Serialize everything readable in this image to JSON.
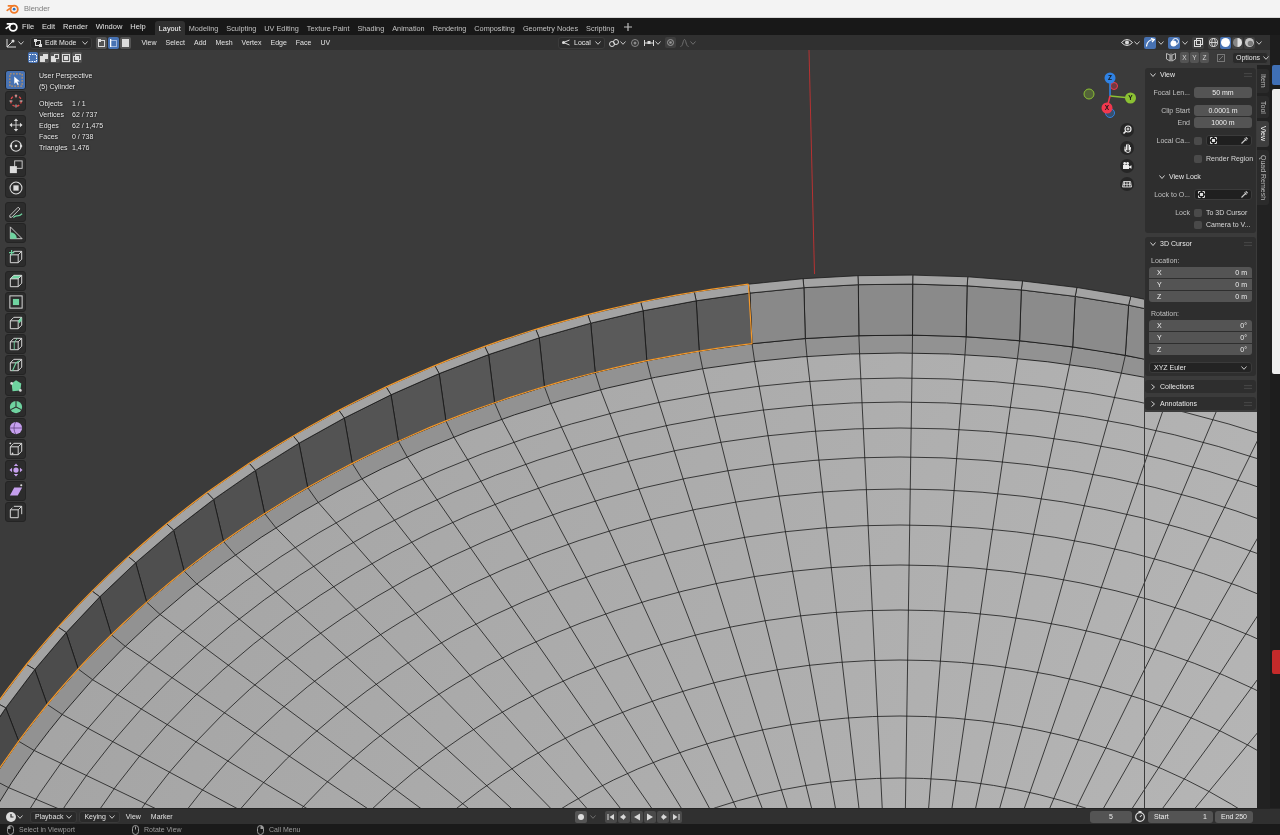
{
  "title_bar": {
    "title": "Blender"
  },
  "menu_bar": {
    "menus": [
      "File",
      "Edit",
      "Render",
      "Window",
      "Help"
    ],
    "workspaces": [
      {
        "label": "Layout",
        "selected": true
      },
      {
        "label": "Modeling",
        "selected": false
      },
      {
        "label": "Sculpting",
        "selected": false
      },
      {
        "label": "UV Editing",
        "selected": false
      },
      {
        "label": "Texture Paint",
        "selected": false
      },
      {
        "label": "Shading",
        "selected": false
      },
      {
        "label": "Animation",
        "selected": false
      },
      {
        "label": "Rendering",
        "selected": false
      },
      {
        "label": "Compositing",
        "selected": false
      },
      {
        "label": "Geometry Nodes",
        "selected": false
      },
      {
        "label": "Scripting",
        "selected": false
      }
    ]
  },
  "viewport_header": {
    "mode": "Edit Mode",
    "select_modes": [
      {
        "kind": "vertex",
        "selected": false
      },
      {
        "kind": "edge",
        "selected": true
      },
      {
        "kind": "face",
        "selected": false
      }
    ],
    "menus": [
      "View",
      "Select",
      "Add",
      "Mesh",
      "Vertex",
      "Edge",
      "Face",
      "UV"
    ],
    "pivot": "Local",
    "snap_on": false,
    "proportional_on": false,
    "gizmos_on": true,
    "overlays_on": true,
    "xray_on": false,
    "shading": [
      {
        "kind": "wireframe",
        "selected": false
      },
      {
        "kind": "solid",
        "selected": true
      },
      {
        "kind": "material",
        "selected": false
      },
      {
        "kind": "rendered",
        "selected": false
      }
    ]
  },
  "tool_settings": {
    "selection_ops": [
      {
        "kind": "set",
        "selected": true
      },
      {
        "kind": "extend",
        "selected": false
      },
      {
        "kind": "subtract",
        "selected": false
      },
      {
        "kind": "invert",
        "selected": false
      },
      {
        "kind": "intersect",
        "selected": false
      }
    ],
    "mirror": [
      {
        "axis": "X",
        "on": false
      },
      {
        "axis": "Y",
        "on": false
      },
      {
        "axis": "Z",
        "on": false
      }
    ],
    "options": "Options"
  },
  "toolbar": {
    "groups": [
      {
        "tools": [
          {
            "kind": "select_box",
            "selected": true
          },
          {
            "kind": "cursor",
            "selected": false
          }
        ]
      },
      {
        "tools": [
          {
            "kind": "move",
            "selected": false
          },
          {
            "kind": "rotate",
            "selected": false
          },
          {
            "kind": "scale",
            "selected": false
          },
          {
            "kind": "transform",
            "selected": false
          }
        ]
      },
      {
        "tools": [
          {
            "kind": "annotate",
            "selected": false
          },
          {
            "kind": "measure",
            "selected": false
          }
        ]
      },
      {
        "tools": [
          {
            "kind": "add_cube",
            "selected": false
          }
        ]
      },
      {
        "tools": [
          {
            "kind": "extrude",
            "selected": false
          },
          {
            "kind": "inset",
            "selected": false
          },
          {
            "kind": "bevel",
            "selected": false
          },
          {
            "kind": "loop_cut",
            "selected": false
          },
          {
            "kind": "knife",
            "selected": false
          },
          {
            "kind": "poly_build",
            "selected": false
          },
          {
            "kind": "spin",
            "selected": false
          },
          {
            "kind": "smooth",
            "selected": false
          },
          {
            "kind": "edge_slide",
            "selected": false
          },
          {
            "kind": "shrink_fatten",
            "selected": false
          },
          {
            "kind": "shear",
            "selected": false
          },
          {
            "kind": "rip",
            "selected": false
          }
        ]
      }
    ]
  },
  "viewport": {
    "view_name": "User Perspective",
    "object_name": "(5) Cylinder",
    "stats": [
      {
        "label": "Objects",
        "value": "1 / 1"
      },
      {
        "label": "Vertices",
        "value": "62 / 737"
      },
      {
        "label": "Edges",
        "value": "62 / 1,475"
      },
      {
        "label": "Faces",
        "value": "0 / 738"
      },
      {
        "label": "Triangles",
        "value": "1,476"
      }
    ]
  },
  "gizmo": {
    "axes": [
      {
        "label": "Z",
        "color": "#2f82e4"
      },
      {
        "label": "Y",
        "color": "#8bc133"
      },
      {
        "label": "X",
        "color": "#f2384e"
      }
    ]
  },
  "sidebar": {
    "tabs": [
      {
        "label": "Item",
        "selected": false
      },
      {
        "label": "Tool",
        "selected": false
      },
      {
        "label": "View",
        "selected": true
      },
      {
        "label": "Quad Remesh",
        "selected": false
      }
    ],
    "panels": [
      {
        "title": "View",
        "expanded": true,
        "groups": [
          [
            {
              "kind": "number",
              "label": "Focal Len...",
              "value": "50 mm"
            }
          ],
          [
            {
              "kind": "number",
              "label": "Clip Start",
              "value": "0.0001 m"
            },
            {
              "kind": "number",
              "label": "End",
              "value": "1000 m"
            }
          ],
          [
            {
              "kind": "object",
              "label": "Local Ca...",
              "checked": false
            }
          ],
          [
            {
              "kind": "checkbox",
              "text": "Render Region",
              "checked": false
            }
          ]
        ],
        "subpanels": [
          {
            "title": "View Lock",
            "expanded": true,
            "groups": [
              [
                {
                  "kind": "object",
                  "label": "Lock to O..."
                }
              ],
              [
                {
                  "kind": "checkbox",
                  "label": "Lock",
                  "text": "To 3D Cursor",
                  "checked": false
                },
                {
                  "kind": "checkbox",
                  "text": "Camera to V...",
                  "checked": false
                }
              ]
            ]
          }
        ]
      },
      {
        "title": "3D Cursor",
        "expanded": true,
        "groups": [
          [
            {
              "kind": "heading",
              "text": "Location:"
            },
            {
              "kind": "vector",
              "items": [
                {
                  "axis": "X",
                  "value": "0 m"
                },
                {
                  "axis": "Y",
                  "value": "0 m"
                },
                {
                  "axis": "Z",
                  "value": "0 m"
                }
              ]
            }
          ],
          [
            {
              "kind": "heading",
              "text": "Rotation:"
            },
            {
              "kind": "vector",
              "items": [
                {
                  "axis": "X",
                  "value": "0°"
                },
                {
                  "axis": "Y",
                  "value": "0°"
                },
                {
                  "axis": "Z",
                  "value": "0°"
                }
              ]
            }
          ],
          [
            {
              "kind": "dropdown",
              "value": "XYZ Euler"
            }
          ]
        ]
      },
      {
        "title": "Collections",
        "expanded": false
      },
      {
        "title": "Annotations",
        "expanded": false
      }
    ]
  },
  "timeline": {
    "menus": [
      {
        "label": "Playback",
        "kind": "dropdown"
      },
      {
        "label": "Keying",
        "kind": "dropdown"
      },
      {
        "label": "View",
        "kind": "menu"
      },
      {
        "label": "Marker",
        "kind": "menu"
      }
    ],
    "auto_keying_on": false,
    "current_frame": "5",
    "start": {
      "label": "Start",
      "value": "1"
    },
    "end": {
      "label": "End",
      "value": "250"
    }
  },
  "status_bar": {
    "hints": [
      {
        "kind": "left",
        "label": "Select in Viewport"
      },
      {
        "kind": "middle",
        "label": "Rotate View"
      },
      {
        "kind": "right",
        "label": "Call Menu"
      }
    ]
  }
}
